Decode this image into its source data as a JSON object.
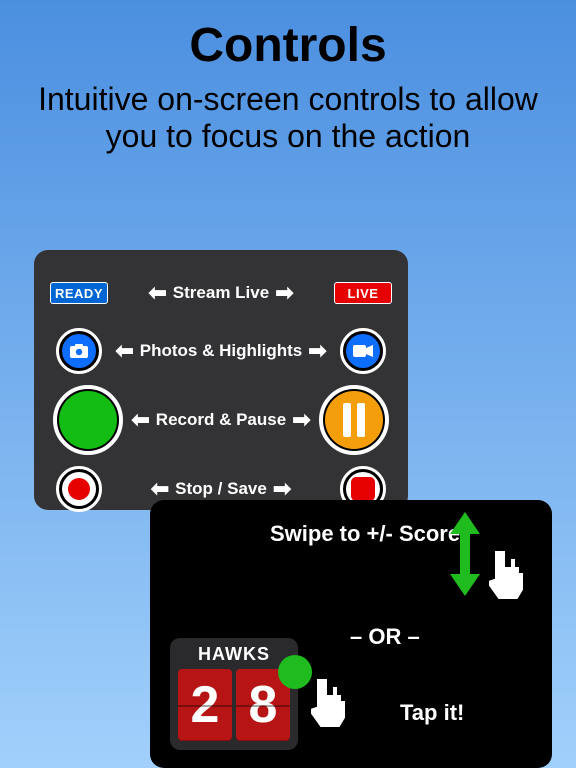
{
  "page": {
    "title": "Controls",
    "subtitle": "Intuitive on-screen controls to allow you to focus on the action"
  },
  "card1": {
    "rows": [
      {
        "left": {
          "type": "badge",
          "text": "READY",
          "color": "#0066d3"
        },
        "mid": "Stream Live",
        "right": {
          "type": "badge",
          "text": "LIVE",
          "color": "#e60000"
        }
      },
      {
        "left": {
          "type": "icon",
          "name": "camera-icon"
        },
        "mid": "Photos & Highlights",
        "right": {
          "type": "icon",
          "name": "video-icon"
        }
      },
      {
        "left": {
          "type": "icon",
          "name": "record-green-icon"
        },
        "mid": "Record & Pause",
        "right": {
          "type": "icon",
          "name": "pause-orange-icon"
        }
      },
      {
        "left": {
          "type": "icon",
          "name": "stop-red-circle-icon"
        },
        "mid": "Stop / Save",
        "right": {
          "type": "icon",
          "name": "stop-red-square-icon"
        }
      }
    ]
  },
  "card2": {
    "swipe_label": "Swipe to +/- Score",
    "or_label": "– OR –",
    "tap_label": "Tap it!",
    "scoreboard": {
      "team": "HAWKS",
      "digits": [
        "2",
        "8"
      ]
    }
  }
}
